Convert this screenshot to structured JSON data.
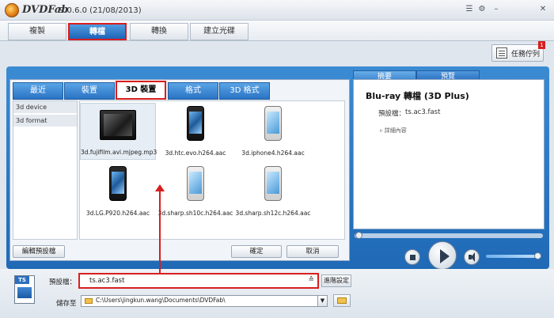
{
  "window": {
    "app_name": "DVDFab",
    "version": "9.0.6.0 (21/08/2013)",
    "controls": [
      "☰",
      "⚙",
      "–",
      "✕"
    ]
  },
  "main_tabs": [
    {
      "label": "複製"
    },
    {
      "label": "轉檔"
    },
    {
      "label": "轉換"
    },
    {
      "label": "建立光碟"
    }
  ],
  "task_queue": {
    "label": "任務佇列",
    "badge": "1"
  },
  "sub_tabs": [
    {
      "label": "最近"
    },
    {
      "label": "裝置"
    },
    {
      "label": "3D 裝置"
    },
    {
      "label": "格式"
    },
    {
      "label": "3D 格式"
    }
  ],
  "categories": [
    {
      "label": "3d device"
    },
    {
      "label": "3d format"
    }
  ],
  "items": [
    {
      "label": "3d.fujifilm.avi.mjpeg.mp3",
      "icon": "tablet-icon"
    },
    {
      "label": "3d.htc.evo.h264.aac",
      "icon": "phone-icon"
    },
    {
      "label": "3d.iphone4.h264.aac",
      "icon": "phone-icon"
    },
    {
      "label": "3d.LG.P920.h264.aac",
      "icon": "phone-icon"
    },
    {
      "label": "3d.sharp.sh10c.h264.aac",
      "icon": "phone-icon"
    },
    {
      "label": "3d.sharp.sh12c.h264.aac",
      "icon": "phone-icon"
    }
  ],
  "buttons": {
    "edit_profile": "編輯預設檔",
    "ok": "確定",
    "cancel": "取消"
  },
  "right_tabs": [
    {
      "label": "摘要"
    },
    {
      "label": "預覽"
    }
  ],
  "summary": {
    "title": "Blu-ray 轉檔 (3D Plus)",
    "profile_label": "預設檔：",
    "profile_value": "ts.ac3.fast",
    "details": "▹ 詳細內容"
  },
  "profile": {
    "label": "預設檔：",
    "value": "ts.ac3.fast",
    "advanced": "進階設定"
  },
  "save": {
    "label": "儲存至",
    "path": "C:\\Users\\jingkun.wang\\Documents\\DVDFab\\"
  },
  "file_icon_text": "TS",
  "colors": {
    "accent": "#1f69b6",
    "highlight": "#d91e1e"
  }
}
